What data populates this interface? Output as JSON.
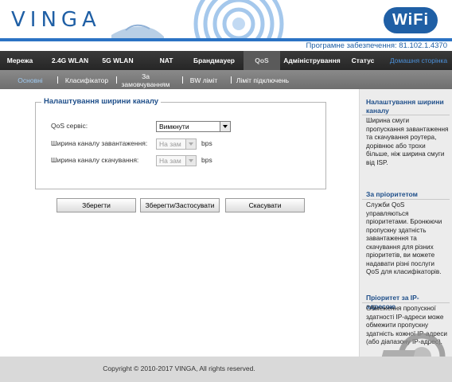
{
  "header": {
    "logo": "VINGA",
    "wifi_badge": "WiFi",
    "firmware": "Програмне забезпечення: 81.102.1.4370"
  },
  "nav": {
    "items": [
      {
        "label": "Мережа"
      },
      {
        "label": "2.4G WLAN"
      },
      {
        "label": "5G WLAN"
      },
      {
        "label": "NAT"
      },
      {
        "label": "Брандмауер"
      },
      {
        "label": "QoS",
        "active": true
      },
      {
        "label": "Адміністрування"
      },
      {
        "label": "Статус"
      },
      {
        "label": "Домашня сторінка"
      }
    ]
  },
  "subnav": {
    "items": [
      {
        "label": "Основні",
        "active": true
      },
      {
        "label": "Класифікатор"
      },
      {
        "label": "За замовчуванням",
        "line1": "За",
        "line2": "замовчуванням"
      },
      {
        "label": "BW ліміт"
      },
      {
        "label": "Ліміт підключень"
      }
    ]
  },
  "panel": {
    "title": "Налаштування ширини каналу",
    "qos_label": "QoS сервіс:",
    "qos_value": "Вимкнути",
    "upload_label": "Ширина каналу завантаження:",
    "upload_value": "На зам",
    "download_label": "Ширина каналу скачування:",
    "download_value": "На зам",
    "unit": "bps"
  },
  "buttons": {
    "save": "Зберегти",
    "save_apply": "Зберегти/Застосувати",
    "cancel": "Скасувати"
  },
  "sidebar": {
    "sections": [
      {
        "title": "Налаштування ширини каналу",
        "text": "Ширина смуги пропускання завантаження та скачування роутера, дорівнює або трохи більше, ніж ширина смуги від ISP."
      },
      {
        "title": "За пріоритетом",
        "text": "Служби QoS управляються пріоритетами. Бронюючи пропускну здатність завантаження та скачування для різних пріоритетів, ви можете надавати різні послуги QoS для класифікаторів."
      },
      {
        "title": "Пріоритет за IP-адресою",
        "text": "Обмеження пропускної здатності IP-адреси може обмежити пропускну здатність кожної IP-адреси (або діапазону IP-адрес)."
      }
    ]
  },
  "footer": {
    "copyright": "Copyright © 2010-2017 VINGA, All rights reserved."
  },
  "colors": {
    "brand_blue": "#1f5fa5",
    "nav_bg": "#2f2f2f",
    "subnav_bg": "#7c7c7c",
    "sidebar_bg": "#ececec"
  }
}
